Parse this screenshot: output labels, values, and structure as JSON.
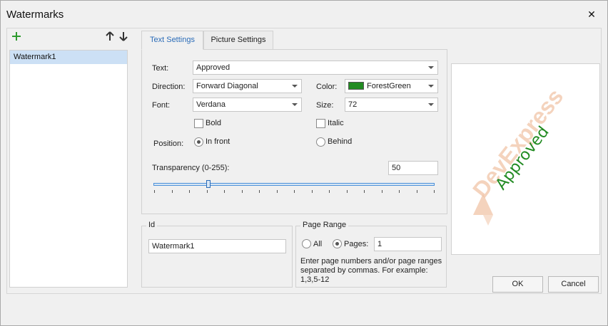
{
  "window": {
    "title": "Watermarks",
    "close_glyph": "✕"
  },
  "toolbar": {
    "add_icon": "plus-icon",
    "up_icon": "arrow-up-icon",
    "down_icon": "arrow-down-icon"
  },
  "watermark_list": {
    "items": [
      "Watermark1"
    ],
    "selected": "Watermark1"
  },
  "tabs": [
    {
      "label": "Text Settings",
      "active": true
    },
    {
      "label": "Picture Settings",
      "active": false
    }
  ],
  "text_settings": {
    "text_label": "Text:",
    "text_value": "Approved",
    "direction_label": "Direction:",
    "direction_value": "Forward Diagonal",
    "color_label": "Color:",
    "color_value": "ForestGreen",
    "color_hex": "#228b22",
    "font_label": "Font:",
    "font_value": "Verdana",
    "size_label": "Size:",
    "size_value": "72",
    "bold_label": "Bold",
    "bold_checked": false,
    "italic_label": "Italic",
    "italic_checked": false,
    "position_label": "Position:",
    "in_front_label": "In front",
    "behind_label": "Behind",
    "position_selected": "In front",
    "transparency_label": "Transparency (0-255):",
    "transparency_value": "50",
    "transparency_level": 50,
    "transparency_max": 255
  },
  "id_group": {
    "title": "Id",
    "value": "Watermark1"
  },
  "page_range": {
    "title": "Page Range",
    "all_label": "All",
    "pages_label": "Pages:",
    "pages_value": "1",
    "selected": "Pages:",
    "hint": "Enter page numbers and/or page ranges separated by commas. For example: 1,3,5-12"
  },
  "preview": {
    "watermark_text": "Approved",
    "watermark_color": "#228b22",
    "logo_text": "DevExpress",
    "logo_color": "#f1c5a8"
  },
  "footer": {
    "ok_label": "OK",
    "cancel_label": "Cancel"
  }
}
